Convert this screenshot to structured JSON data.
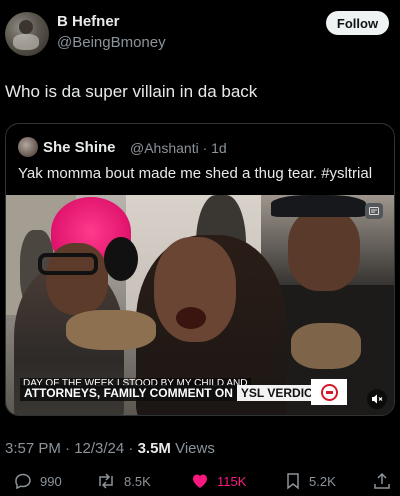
{
  "author": {
    "name": "B Hefner",
    "handle": "@BeingBmoney",
    "follow_label": "Follow"
  },
  "tweet": {
    "text": "Who is da super villain in da back"
  },
  "quoted": {
    "name": "She Shine",
    "handle_time": "@Ahshanti · 1d",
    "text": "Yak momma bout made me shed a thug tear. #ysltrial",
    "video": {
      "chyron_top": "DAY OF THE WEEK I STOOD BY MY CHILD AND",
      "chyron_dark": "ATTORNEYS, FAMILY COMMENT ON",
      "chyron_light": "YSL VERDICTS",
      "logo_icon": "news-channel-logo-icon",
      "corner_icon": "badge-icon",
      "mute_icon": "volume-muted-icon"
    }
  },
  "meta": {
    "time_date": "3:57 PM · 12/3/24 · ",
    "views_count": "3.5M",
    "views_label": " Views"
  },
  "actions": {
    "replies": "990",
    "reposts": "8.5K",
    "likes": "115K",
    "bookmarks": "5.2K"
  },
  "colors": {
    "like_active": "#f91880",
    "secondary_text": "#8b949b",
    "primary_text": "#e7e9ea",
    "background": "#000000"
  }
}
